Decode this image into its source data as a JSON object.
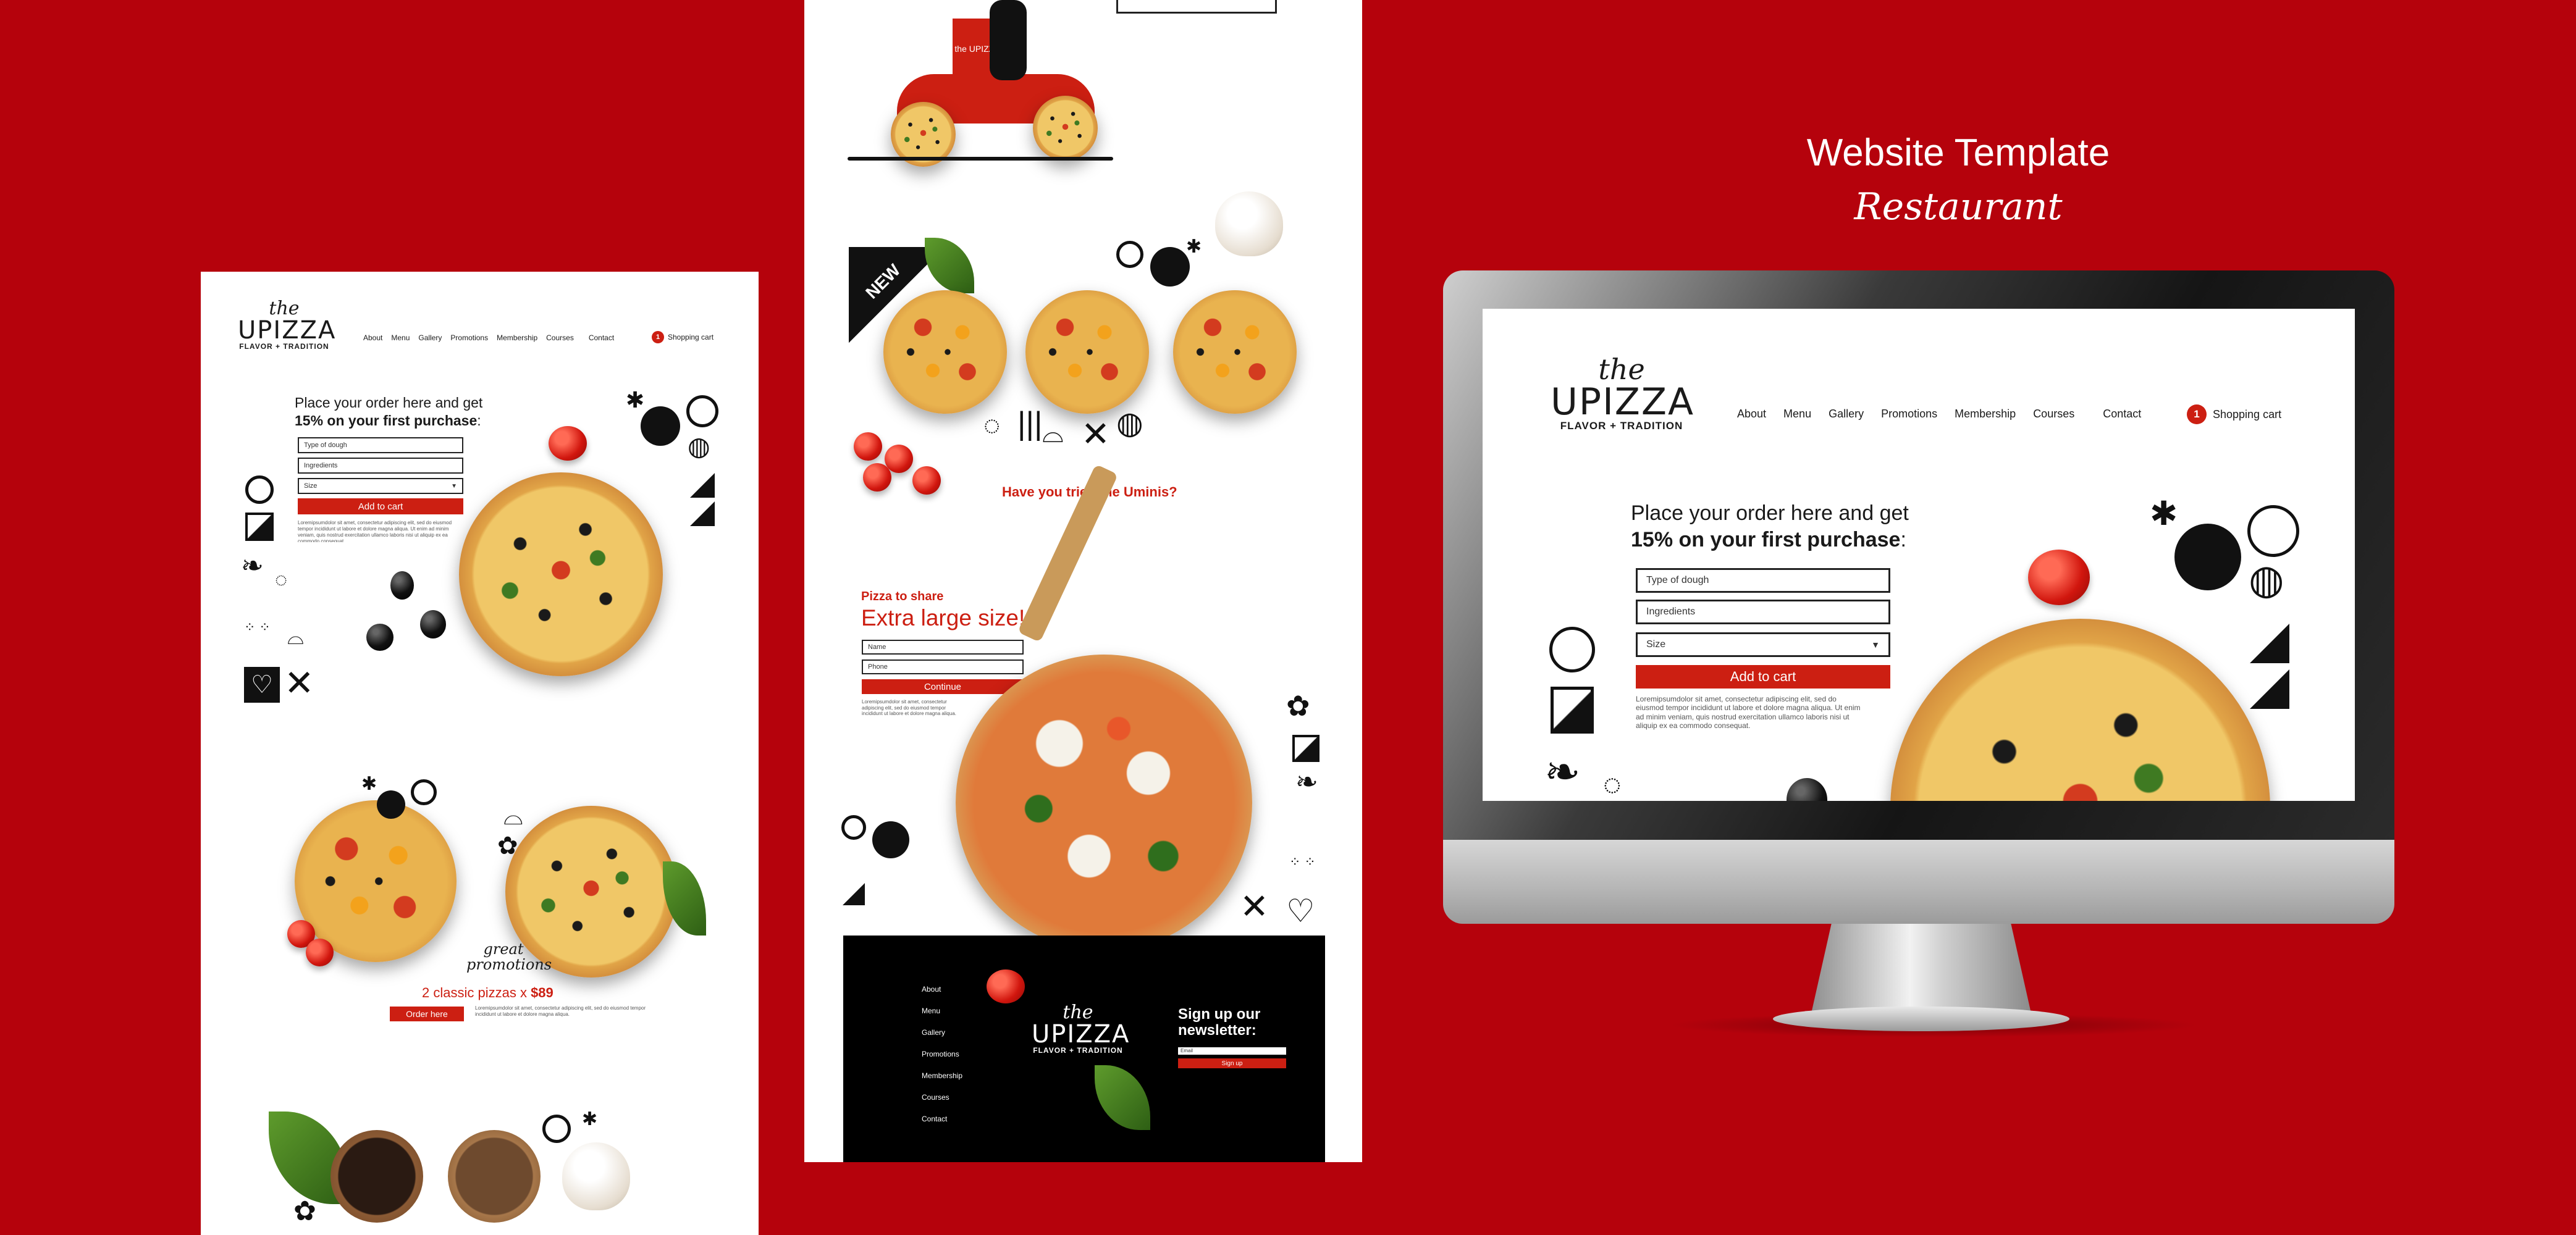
{
  "colors": {
    "background": "#b5020c",
    "accent": "#cc1f12",
    "footer": "#000000"
  },
  "heading": {
    "title": "Website Template",
    "subtitle": "Restaurant"
  },
  "brand": {
    "the": "the",
    "name": "UPIZZA",
    "tagline": "FLAVOR + TRADITION"
  },
  "nav": [
    "About",
    "Menu",
    "Gallery",
    "Promotions",
    "Membership",
    "Courses",
    "Contact"
  ],
  "cart": {
    "count": "1",
    "label": "Shopping cart"
  },
  "order": {
    "line1": "Place your order here and get",
    "line2": "15% on your first purchase",
    "line2_suffix": ":",
    "dough_placeholder": "Type of dough",
    "ingredients_placeholder": "Ingredients",
    "size_placeholder": "Size",
    "add_to_cart": "Add to cart",
    "lorem": "Loremipsumdolor sit amet, consectetur adipiscing elit, sed do eiusmod tempor incididunt ut labore et dolore magna aliqua. Ut enim ad minim veniam, quis nostrud exercitation ullamco laboris nisi ut aliquip ex ea commodo consequat."
  },
  "promo": {
    "script": "great promotions",
    "offer_prefix": "2 classic pizzas x ",
    "offer_price": "$89",
    "order_here": "Order here",
    "lorem": "Loremipsumdolor sit amet, consectetur adipiscing elit, sed do eiusmod tempor incididunt ut labore et dolore magna aliqua."
  },
  "middle": {
    "new_badge": "NEW",
    "tried": "Have you tried the Uminis?",
    "share_small": "Pizza to share",
    "share_big": "Extra large size!",
    "name_placeholder": "Name",
    "phone_placeholder": "Phone",
    "continue": "Continue",
    "lorem": "Loremipsumdolor sit amet, consectetur adipiscing elit, sed do eiusmod tempor incididunt ut labore et dolore magna aliqua.",
    "scooter_logo": "the UPIZZA"
  },
  "footer": {
    "links": [
      "About",
      "Menu",
      "Gallery",
      "Promotions",
      "Membership",
      "Courses",
      "Contact"
    ],
    "newsletter_title": "Sign up our newsletter:",
    "email_placeholder": "Email",
    "signup": "Sign up"
  }
}
